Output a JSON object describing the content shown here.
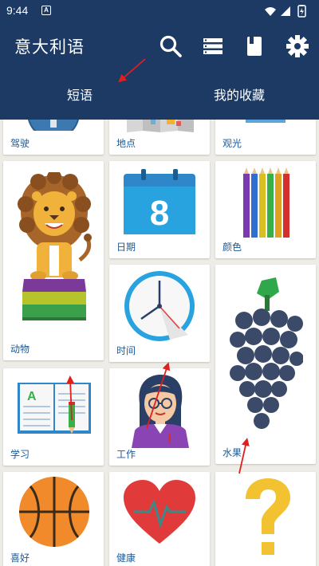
{
  "status_bar": {
    "time": "9:44",
    "notification_icon": "A"
  },
  "app_bar": {
    "title": "意大利语"
  },
  "tabs": [
    {
      "label": "短语"
    },
    {
      "label": "我的收藏"
    }
  ],
  "categories": [
    {
      "label": "驾驶"
    },
    {
      "label": "地点"
    },
    {
      "label": "观光"
    },
    {
      "label": "动物"
    },
    {
      "label": "日期"
    },
    {
      "label": "颜色"
    },
    {
      "label": "时间"
    },
    {
      "label": "学习"
    },
    {
      "label": "工作"
    },
    {
      "label": "水果"
    },
    {
      "label": "喜好"
    },
    {
      "label": "健康"
    },
    {
      "label": ""
    }
  ],
  "calendar_day": "8",
  "colors": {
    "primary": "#1c3a64",
    "accent_arrow": "#e01f1f",
    "label_blue": "#1a5a9a"
  },
  "icons": [
    "search-icon",
    "list-icon",
    "book-icon",
    "gear-icon"
  ]
}
